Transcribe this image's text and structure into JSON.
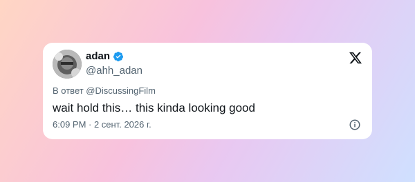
{
  "tweet": {
    "author": {
      "name": "adan",
      "handle": "@ahh_adan",
      "verified": true
    },
    "reply_to": "В ответ @DiscussingFilm",
    "text": "wait hold this… this kinda looking good",
    "timestamp": "6:09 PM · 2 сент. 2026 г."
  },
  "icons": {
    "brand": "x-logo-icon",
    "verified": "verified-badge-icon",
    "info": "info-icon"
  },
  "colors": {
    "verified_blue": "#1d9bf0",
    "text_primary": "#0f1419",
    "text_secondary": "#536471"
  }
}
